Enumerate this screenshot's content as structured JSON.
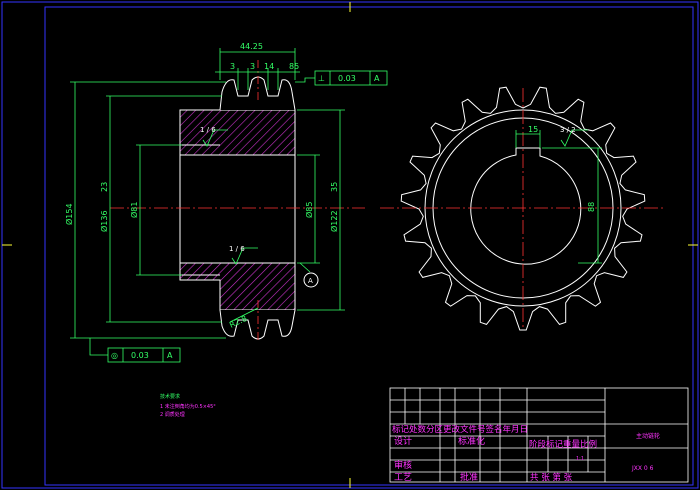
{
  "drawing": {
    "dims": {
      "top_total": "44.25",
      "top_a": "3",
      "top_b": "3",
      "top_c": "14",
      "top_d": "85",
      "d_outer": "Ø154",
      "d_root": "Ø136",
      "d_23": "23",
      "d_bore": "Ø81",
      "d_hub": "Ø85",
      "d_122": "Ø122",
      "d_35": "35",
      "rough_1": "1 / 6",
      "rough_2": "1 / 6",
      "datum_a": "A",
      "small_dim": "R2.8",
      "key_width": "15",
      "key_height": "88",
      "rough_3": "3 / 2"
    },
    "tolerance_top": {
      "sym": "⊥",
      "val": "0.03",
      "ref": "A"
    },
    "tolerance_bottom": {
      "sym": "◎",
      "val": "0.03",
      "ref": "A"
    },
    "notes": {
      "heading": "技术要求",
      "line1": "1  未注倒角均为0.5×45°",
      "line2": "2  调质处理"
    }
  },
  "title_block": {
    "revision_header": "标记处数分区更改文件号签名年月日",
    "design": "设计",
    "standardize": "标准化",
    "stage_mark": "阶段标记重量比例",
    "scale": "1:1",
    "review": "审核",
    "process": "工艺",
    "approve": "批准",
    "sheets": "共  张  第  张",
    "part_name": "主动链轮",
    "drawing_no": "JXX  0 6"
  },
  "colors": {
    "line": "#ffffff",
    "dim": "#33ff66",
    "center": "#ff3333",
    "hatch": "#cc33cc",
    "title_text": "#ff33ff",
    "frame": "#3333ff",
    "ticks": "#ffff33"
  }
}
